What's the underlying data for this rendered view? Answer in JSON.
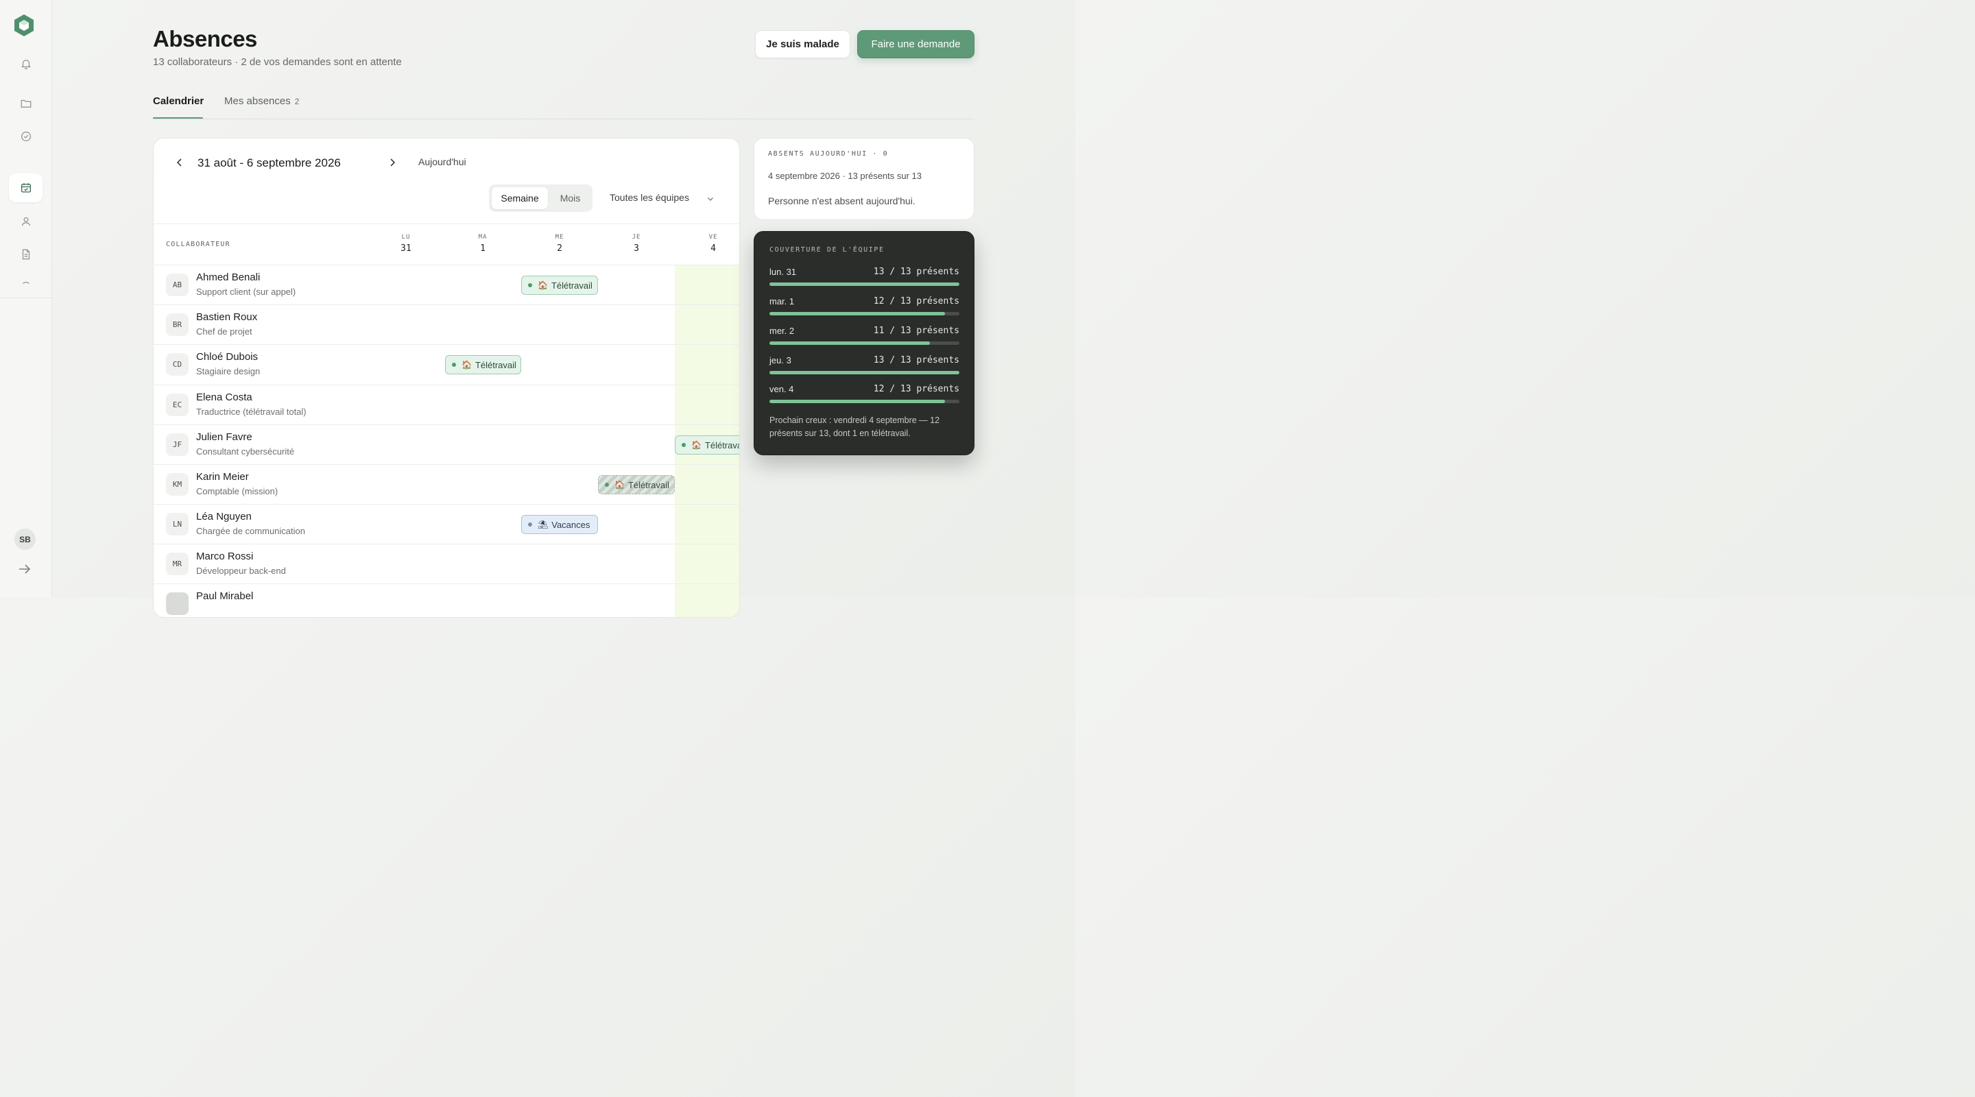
{
  "sidebar": {
    "logo": "logo-hexagon",
    "icons": [
      "bell-icon",
      "folder-icon",
      "check-circle-icon",
      "calendar-icon",
      "user-icon",
      "document-icon"
    ],
    "user_initials": "SB"
  },
  "header": {
    "title": "Absences",
    "subtitle": "13 collaborateurs · 2 de vos demandes sont en attente",
    "sick_button": "Je suis malade",
    "request_button": "Faire une demande"
  },
  "tabs": [
    {
      "label": "Calendrier",
      "active": true
    },
    {
      "label": "Mes absences",
      "count": "2",
      "active": false
    }
  ],
  "calendar": {
    "range": "31 août - 6 septembre 2026",
    "today_button": "Aujourd'hui",
    "view_week": "Semaine",
    "view_month": "Mois",
    "team_filter": "Toutes les équipes",
    "column_label": "COLLABORATEUR",
    "days": [
      {
        "dow": "LU",
        "num": "31"
      },
      {
        "dow": "MA",
        "num": "1"
      },
      {
        "dow": "ME",
        "num": "2"
      },
      {
        "dow": "JE",
        "num": "3"
      },
      {
        "dow": "VE",
        "num": "4"
      }
    ],
    "rows": [
      {
        "initials": "AB",
        "name": "Ahmed Benali",
        "role": "Support client (sur appel)"
      },
      {
        "initials": "BR",
        "name": "Bastien Roux",
        "role": "Chef de projet"
      },
      {
        "initials": "CD",
        "name": "Chloé Dubois",
        "role": "Stagiaire design"
      },
      {
        "initials": "EC",
        "name": "Elena Costa",
        "role": "Traductrice (télétravail total)"
      },
      {
        "initials": "JF",
        "name": "Julien Favre",
        "role": "Consultant cybersécurité"
      },
      {
        "initials": "KM",
        "name": "Karin Meier",
        "role": "Comptable (mission)"
      },
      {
        "initials": "LN",
        "name": "Léa Nguyen",
        "role": "Chargée de communication"
      },
      {
        "initials": "MR",
        "name": "Marco Rossi",
        "role": "Développeur back-end"
      },
      {
        "initials": "",
        "name": "Paul Mirabel",
        "role": ""
      }
    ],
    "events": {
      "remote_label": "Télétravail",
      "remote_cut_label": "Télétrava",
      "vacation_label": "Vacances",
      "remote_emoji": "🏠",
      "vacation_emoji": "⛱"
    }
  },
  "today_panel": {
    "label": "ABSENTS AUJOURD'HUI · 0",
    "date_line": "4 septembre 2026 · 13 présents sur 13",
    "empty_text": "Personne n'est absent aujourd'hui."
  },
  "coverage": {
    "label": "COUVERTURE DE L'ÉQUIPE",
    "days": [
      {
        "day": "lun. 31",
        "count": "13 / 13 présents",
        "ratio": 1.0
      },
      {
        "day": "mar. 1",
        "count": "12 / 13 présents",
        "ratio": 0.923
      },
      {
        "day": "mer. 2",
        "count": "11 / 13 présents",
        "ratio": 0.846
      },
      {
        "day": "jeu. 3",
        "count": "13 / 13 présents",
        "ratio": 1.0
      },
      {
        "day": "ven. 4",
        "count": "12 / 13 présents",
        "ratio": 0.923
      }
    ],
    "note": "Prochain creux : vendredi 4 septembre — 12 présents sur 13, dont 1 en télétravail."
  },
  "colors": {
    "accent": "#5e9a78",
    "today_column": "#f4fbe4",
    "coverage_bg": "#2b2d2b",
    "coverage_fill": "#7fc497"
  }
}
